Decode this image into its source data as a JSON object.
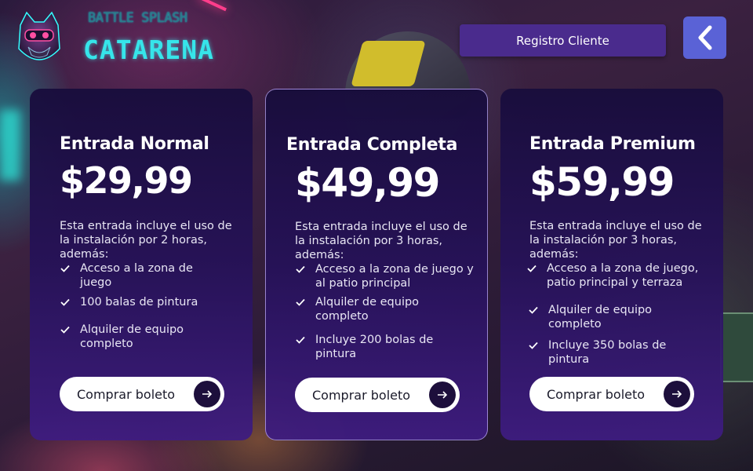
{
  "header": {
    "brand_small": "BATTLE SPLASH",
    "brand_big": "CATARENA",
    "register_label": "Registro Cliente",
    "back_icon": "chevron-left-icon"
  },
  "colors": {
    "card_bg": "#26125a",
    "register_bg": "#4a2b8d",
    "back_bg": "#5a62d6",
    "brand_cyan": "#36e5ea"
  },
  "plans": [
    {
      "name": "Entrada Normal",
      "price": "$29,99",
      "description": "Esta entrada incluye el uso de la instalación por 2 horas, además:",
      "features": [
        "Acceso a la zona de juego",
        "100 balas de pintura",
        "Alquiler de equipo completo"
      ],
      "button": "Comprar boleto"
    },
    {
      "name": "Entrada Completa",
      "price": "$49,99",
      "description": "Esta entrada incluye el uso de la instalación por 3 horas, además:",
      "features": [
        "Acceso a la zona de juego y al patio principal",
        "Alquiler de equipo completo",
        "Incluye 200 bolas de pintura"
      ],
      "button": "Comprar boleto"
    },
    {
      "name": "Entrada Premium",
      "price": "$59,99",
      "description": "Esta entrada incluye el uso de la instalación por 3 horas, además:",
      "features": [
        "Acceso a la zona de juego, patio principal y terraza",
        "Alquiler de equipo completo",
        "Incluye 350 bolas de pintura"
      ],
      "button": "Comprar boleto"
    }
  ]
}
